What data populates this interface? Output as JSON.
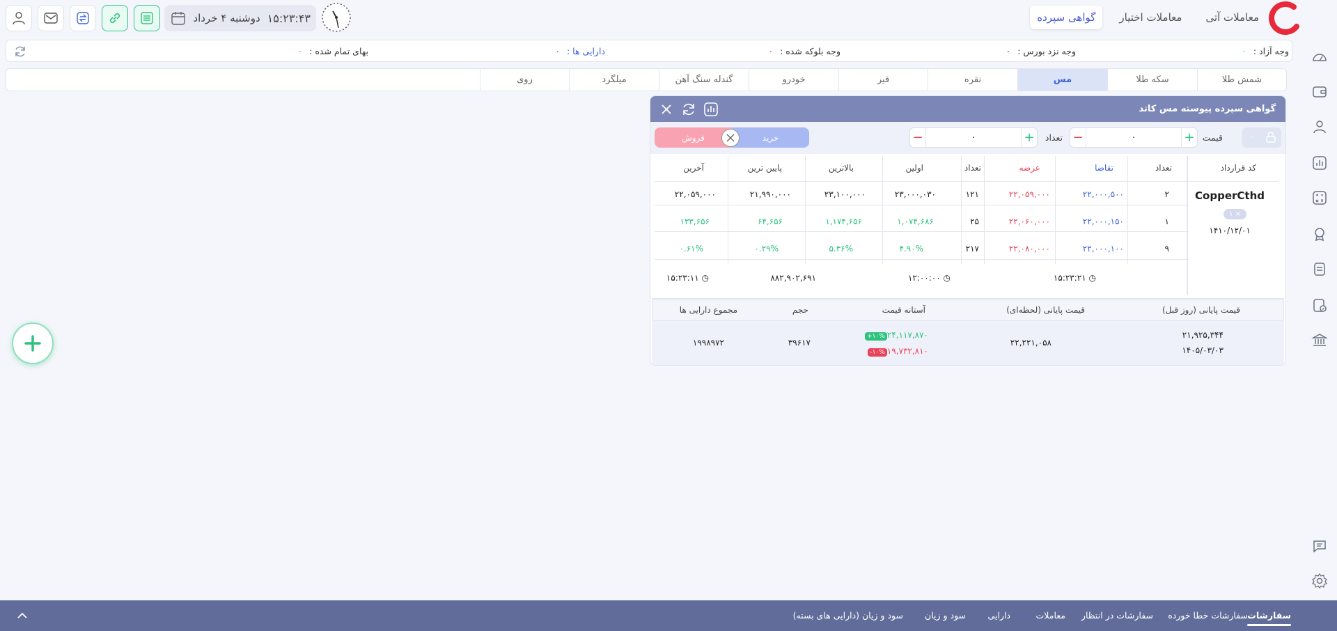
{
  "header": {
    "top_tabs": [
      "معاملات آتی",
      "معاملات اختیار",
      "گواهی سپرده"
    ],
    "active_tab": "گواهی سپرده",
    "time": "۱۵:۲۳:۴۳",
    "date": "دوشنبه ۴ خرداد"
  },
  "balances": {
    "free_cash_label": "وجه آزاد :",
    "free_cash_value": "۰",
    "exchange_cash_label": "وجه نزد بورس :",
    "exchange_cash_value": "۰",
    "blocked_cash_label": "وجه بلوکه شده :",
    "blocked_cash_value": "۰",
    "assets_label": "دارایی ها :",
    "assets_value": "۰",
    "cost_label": "بهای تمام شده :",
    "cost_value": "۰"
  },
  "commodity_tabs": [
    "شمش طلا",
    "سکه طلا",
    "مس",
    "نقره",
    "قیر",
    "خودرو",
    "گندله سنگ آهن",
    "میلگرد",
    "روی"
  ],
  "active_commodity": "مس",
  "panel": {
    "title": "گواهی سپرده پیوسته مس کاتد",
    "price_label": "قیمت",
    "price_value": "۰",
    "qty_label": "تعداد",
    "qty_value": "۰",
    "lock_value": "۰",
    "buy_label": "خرید",
    "sell_label": "فروش"
  },
  "market": {
    "headers": {
      "contract_code": "کد قرارداد",
      "bid_count": "تعداد",
      "bid": "تقاضا",
      "ask": "عرضه",
      "ask_count": "تعداد",
      "first": "اولین",
      "high": "بالاترین",
      "low": "پایین ترین",
      "last": "آخرین"
    },
    "symbol": "CopperCthd",
    "symbol_pill": "۱ ×",
    "symbol_date": "۱۴۱۰/۱۲/۰۱",
    "rows": [
      {
        "bid_count": "۲",
        "bid": "۲۲,۰۰۰,۵۰۰",
        "ask": "۲۲,۰۵۹,۰۰۰",
        "ask_count": "۱۲۱"
      },
      {
        "bid_count": "۱",
        "bid": "۲۲,۰۰۰,۱۵۰",
        "ask": "۲۲,۰۶۰,۰۰۰",
        "ask_count": "۲۵"
      },
      {
        "bid_count": "۹",
        "bid": "۲۲,۰۰۰,۱۰۰",
        "ask": "۲۲,۰۸۰,۰۰۰",
        "ask_count": "۲۱۷"
      }
    ],
    "prices": {
      "first": "۲۳,۰۰۰,۰۳۰",
      "high": "۲۳,۱۰۰,۰۰۰",
      "low": "۲۱,۹۹۰,۰۰۰",
      "last": "۲۲,۰۵۹,۰۰۰"
    },
    "changes": {
      "first": "۱,۰۷۴,۶۸۶",
      "high": "۱,۱۷۴,۶۵۶",
      "low": "۶۴,۶۵۶",
      "last": "۱۳۳,۶۵۶"
    },
    "percents": {
      "first": "۴.۹۰%",
      "high": "۵.۳۶%",
      "low": "۰.۲۹%",
      "last": "۰.۶۱%"
    },
    "footer": {
      "time1": "۱۵:۲۳:۲۱",
      "time2": "۱۲:۰۰:۰۰",
      "volume": "۸۸۲,۹۰۲,۶۹۱",
      "time3": "۱۵:۲۳:۱۱"
    }
  },
  "summary": {
    "headers": {
      "prev_close": "قیمت پایانی (روز قبل)",
      "live_close": "قیمت پایانی (لحظه‌ای)",
      "price_limit": "آستانه قیمت",
      "volume": "حجم",
      "total_assets": "مجموع دارایی ها"
    },
    "prev_close": "۲۱,۹۲۵,۳۴۴",
    "prev_date": "۱۴۰۵/۰۳/۰۳",
    "live_close": "۲۲,۲۲۱,۰۵۸",
    "limit_high": "۲۴,۱۱۷,۸۷۰",
    "limit_high_badge": "+۱۰%",
    "limit_low": "۱۹,۷۳۲,۸۱۰",
    "limit_low_badge": "-۱۰%",
    "volume": "۳۹۶۱۷",
    "total_assets": "۱۹۹۸۹۷۲"
  },
  "bottom_tabs": [
    "سفارشات",
    "سفارشات خطا خورده",
    "سفارشات در انتظار",
    "معاملات",
    "دارایی",
    "سود و زیان",
    "سود و زیان (دارایی های بسته)"
  ],
  "active_bottom_tab": "سفارشات",
  "colors": {
    "accent": "#3d63dd",
    "green": "#2ec27e",
    "red": "#e8435a",
    "panel_header": "#7d87b7",
    "bottom_bar": "#616c9a"
  }
}
